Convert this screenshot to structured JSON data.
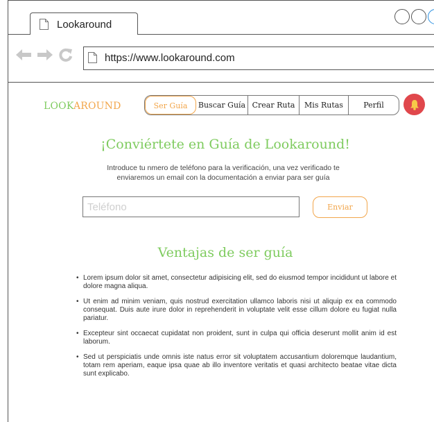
{
  "browser": {
    "tab_title": "Lookaround",
    "url": "https://www.lookaround.com"
  },
  "app": {
    "logo_part1": "LOOK",
    "logo_part2": "AROUND",
    "menu": [
      "Ser Guía",
      "Buscar Guía",
      "Crear Ruta",
      "Mis Rutas",
      "Perfil"
    ],
    "active_menu": "Ser Guía",
    "title": "¡Conviértete en Guía de Lookaround!",
    "subtitle_line1": "Introduce tu nmero de teléfono para la verificación, una vez verificado te",
    "subtitle_line2": "enviaremos un email con la documentación a enviar para ser guía",
    "phone_placeholder": "Teléfono",
    "send_label": "Enviar",
    "benefits_title": "Ventajas de ser guía",
    "benefits": [
      "Lorem ipsum dolor sit amet, consectetur adipisicing elit, sed do eiusmod tempor incididunt ut labore et dolore magna aliqua.",
      "Ut enim ad minim veniam, quis nostrud exercitation ullamco laboris nisi ut aliquip ex ea commodo consequat. Duis aute irure dolor in reprehenderit in voluptate velit esse cillum dolore eu fugiat nulla pariatur.",
      "Excepteur sint occaecat cupidatat non proident, sunt in culpa qui officia deserunt mollit anim id est laborum.",
      "Sed ut perspiciatis unde omnis iste natus error sit voluptatem accusantium doloremque laudantium, totam rem aperiam, eaque ipsa quae ab illo inventore veritatis et quasi architecto beatae vitae dicta sunt explicabo."
    ]
  },
  "colors": {
    "brand_green": "#7ecb5e",
    "brand_orange": "#f2a64b",
    "bell_red": "#e0474c"
  },
  "icons": {
    "back": "arrow-left-icon",
    "forward": "arrow-right-icon",
    "reload": "reload-icon",
    "page": "page-icon",
    "notification": "bell-icon"
  }
}
